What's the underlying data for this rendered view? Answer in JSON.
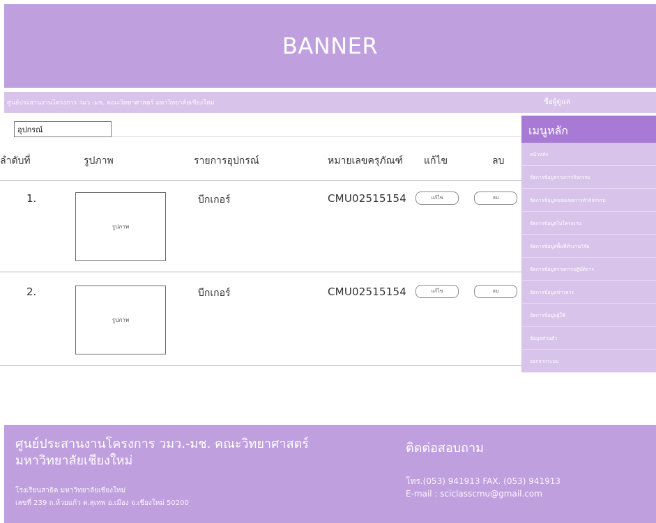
{
  "banner": {
    "text": "BANNER"
  },
  "subbar": {
    "org": "ศูนย์ประสานงานโครงการ วมว.-มช. คณะวิทยาศาสตร์ มหาวิทยาลัยเชียงใหม่",
    "user": "ชื่อผู้ดูแล"
  },
  "search": {
    "value": "อุปกรณ์"
  },
  "table": {
    "headers": [
      "ลำดับที่",
      "รูปภาพ",
      "รายการอุปกรณ์",
      "หมายเลขครุภัณฑ์",
      "แก้ไข",
      "ลบ"
    ],
    "rows": [
      {
        "index": "1.",
        "image_label": "รูปภาพ",
        "name": "บีกเกอร์",
        "code": "CMU02515154",
        "edit": "แก้ไข",
        "delete": "ลบ"
      },
      {
        "index": "2.",
        "image_label": "รูปภาพ",
        "name": "บีกเกอร์",
        "code": "CMU02515154",
        "edit": "แก้ไข",
        "delete": "ลบ"
      }
    ]
  },
  "sidebar": {
    "title": "เมนูหลัก",
    "items": [
      "หน้าหลัก",
      "จัดการข้อมูลรายการกิจกรรม",
      "จัดการข้อมูลขอบเขตการทำกิจกรรม",
      "จัดการข้อมูลใบโครงงาน",
      "จัดการข้อมูลพื้นที่ทำงานวิจัย",
      "จัดการข้อมูลรายการปฏิบัติการ",
      "จัดการข้อมูลข่าวสาร",
      "จัดการข้อมูลผู้ใช้",
      "ข้อมูลส่วนตัว",
      "ออกจากระบบ"
    ]
  },
  "footer": {
    "title_line1": "ศูนย์ประสานงานโครงการ วมว.-มช. คณะวิทยาศาสตร์",
    "title_line2": "มหาวิทยาลัยเชียงใหม่",
    "address_line1": "โรงเรียนสาธิต มหาวิทยาลัยเชียงใหม่",
    "address_line2": "เลขที่ 239 ถ.ห้วยแก้ว ต.สุเทพ อ.เมือง จ.เชียงใหม่ 50200",
    "contact_title": "ติดต่อสอบถาม",
    "phone": "โทร.(053) 941913 FAX. (053) 941913",
    "email": "E-mail : sciclasscmu@gmail.com"
  },
  "colors": {
    "banner": "#bf9fde",
    "subbar": "#d8c3ea",
    "menu_title": "#a87ad6",
    "menu_item": "#d8c3ea"
  }
}
